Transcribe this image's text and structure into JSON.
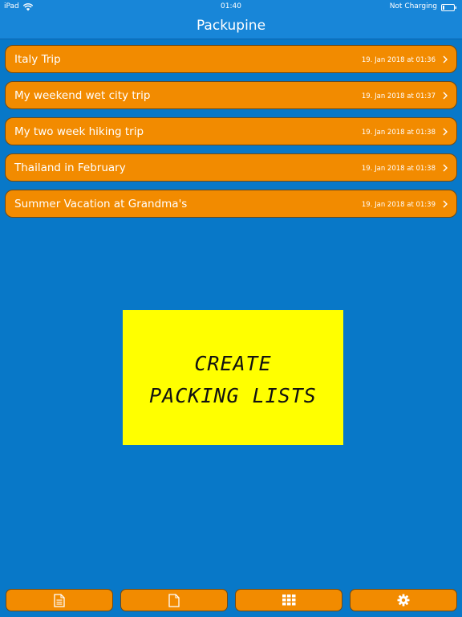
{
  "status_bar": {
    "device": "iPad",
    "time": "01:40",
    "battery_status": "Not Charging"
  },
  "nav": {
    "title": "Packupine"
  },
  "trips": [
    {
      "name": "Italy Trip",
      "date": "19. Jan 2018 at 01:36"
    },
    {
      "name": "My weekend wet city trip",
      "date": "19. Jan 2018 at 01:37"
    },
    {
      "name": "My two week hiking trip",
      "date": "19. Jan 2018 at 01:38"
    },
    {
      "name": "Thailand in February",
      "date": "19. Jan 2018 at 01:38"
    },
    {
      "name": "Summer Vacation at Grandma's",
      "date": "19. Jan 2018 at 01:39"
    }
  ],
  "promo": {
    "line1": "CREATE",
    "line2": "PACKING LISTS"
  },
  "toolbar": {
    "buttons": [
      {
        "icon": "document-lines-icon"
      },
      {
        "icon": "blank-document-icon"
      },
      {
        "icon": "grid-icon"
      },
      {
        "icon": "gear-icon"
      }
    ]
  },
  "colors": {
    "background": "#0878c8",
    "bar": "#1886d8",
    "row": "#f28b00",
    "promo": "#ffff00"
  }
}
